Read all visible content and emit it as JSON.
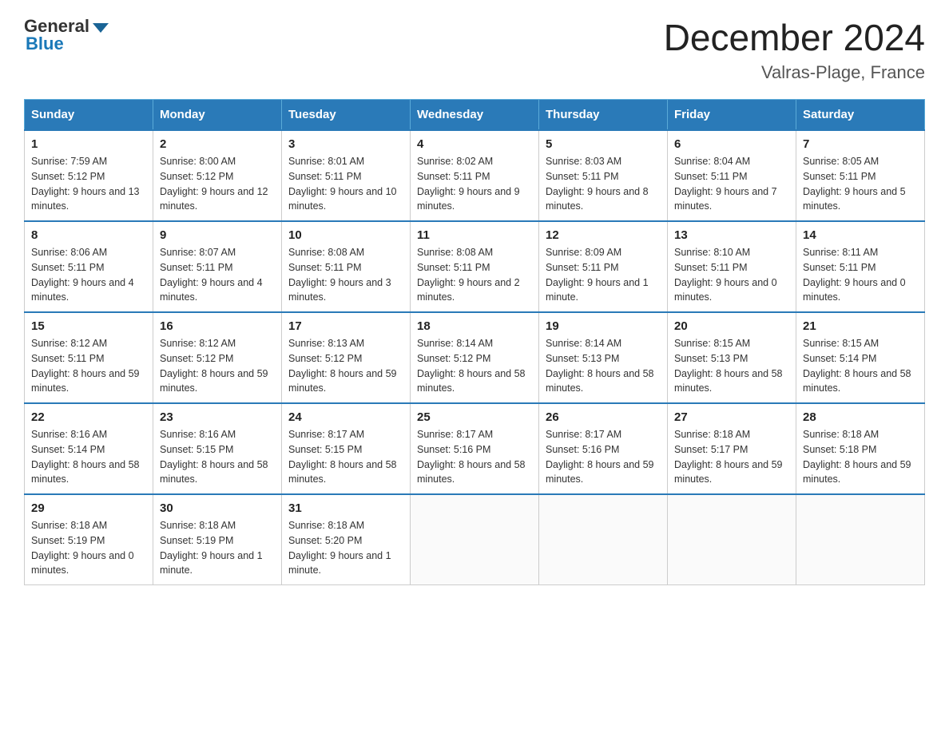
{
  "header": {
    "logo": {
      "general": "General",
      "blue": "Blue"
    },
    "title": "December 2024",
    "location": "Valras-Plage, France"
  },
  "weekdays": [
    "Sunday",
    "Monday",
    "Tuesday",
    "Wednesday",
    "Thursday",
    "Friday",
    "Saturday"
  ],
  "weeks": [
    [
      {
        "day": "1",
        "sunrise": "7:59 AM",
        "sunset": "5:12 PM",
        "daylight": "9 hours and 13 minutes."
      },
      {
        "day": "2",
        "sunrise": "8:00 AM",
        "sunset": "5:12 PM",
        "daylight": "9 hours and 12 minutes."
      },
      {
        "day": "3",
        "sunrise": "8:01 AM",
        "sunset": "5:11 PM",
        "daylight": "9 hours and 10 minutes."
      },
      {
        "day": "4",
        "sunrise": "8:02 AM",
        "sunset": "5:11 PM",
        "daylight": "9 hours and 9 minutes."
      },
      {
        "day": "5",
        "sunrise": "8:03 AM",
        "sunset": "5:11 PM",
        "daylight": "9 hours and 8 minutes."
      },
      {
        "day": "6",
        "sunrise": "8:04 AM",
        "sunset": "5:11 PM",
        "daylight": "9 hours and 7 minutes."
      },
      {
        "day": "7",
        "sunrise": "8:05 AM",
        "sunset": "5:11 PM",
        "daylight": "9 hours and 5 minutes."
      }
    ],
    [
      {
        "day": "8",
        "sunrise": "8:06 AM",
        "sunset": "5:11 PM",
        "daylight": "9 hours and 4 minutes."
      },
      {
        "day": "9",
        "sunrise": "8:07 AM",
        "sunset": "5:11 PM",
        "daylight": "9 hours and 4 minutes."
      },
      {
        "day": "10",
        "sunrise": "8:08 AM",
        "sunset": "5:11 PM",
        "daylight": "9 hours and 3 minutes."
      },
      {
        "day": "11",
        "sunrise": "8:08 AM",
        "sunset": "5:11 PM",
        "daylight": "9 hours and 2 minutes."
      },
      {
        "day": "12",
        "sunrise": "8:09 AM",
        "sunset": "5:11 PM",
        "daylight": "9 hours and 1 minute."
      },
      {
        "day": "13",
        "sunrise": "8:10 AM",
        "sunset": "5:11 PM",
        "daylight": "9 hours and 0 minutes."
      },
      {
        "day": "14",
        "sunrise": "8:11 AM",
        "sunset": "5:11 PM",
        "daylight": "9 hours and 0 minutes."
      }
    ],
    [
      {
        "day": "15",
        "sunrise": "8:12 AM",
        "sunset": "5:11 PM",
        "daylight": "8 hours and 59 minutes."
      },
      {
        "day": "16",
        "sunrise": "8:12 AM",
        "sunset": "5:12 PM",
        "daylight": "8 hours and 59 minutes."
      },
      {
        "day": "17",
        "sunrise": "8:13 AM",
        "sunset": "5:12 PM",
        "daylight": "8 hours and 59 minutes."
      },
      {
        "day": "18",
        "sunrise": "8:14 AM",
        "sunset": "5:12 PM",
        "daylight": "8 hours and 58 minutes."
      },
      {
        "day": "19",
        "sunrise": "8:14 AM",
        "sunset": "5:13 PM",
        "daylight": "8 hours and 58 minutes."
      },
      {
        "day": "20",
        "sunrise": "8:15 AM",
        "sunset": "5:13 PM",
        "daylight": "8 hours and 58 minutes."
      },
      {
        "day": "21",
        "sunrise": "8:15 AM",
        "sunset": "5:14 PM",
        "daylight": "8 hours and 58 minutes."
      }
    ],
    [
      {
        "day": "22",
        "sunrise": "8:16 AM",
        "sunset": "5:14 PM",
        "daylight": "8 hours and 58 minutes."
      },
      {
        "day": "23",
        "sunrise": "8:16 AM",
        "sunset": "5:15 PM",
        "daylight": "8 hours and 58 minutes."
      },
      {
        "day": "24",
        "sunrise": "8:17 AM",
        "sunset": "5:15 PM",
        "daylight": "8 hours and 58 minutes."
      },
      {
        "day": "25",
        "sunrise": "8:17 AM",
        "sunset": "5:16 PM",
        "daylight": "8 hours and 58 minutes."
      },
      {
        "day": "26",
        "sunrise": "8:17 AM",
        "sunset": "5:16 PM",
        "daylight": "8 hours and 59 minutes."
      },
      {
        "day": "27",
        "sunrise": "8:18 AM",
        "sunset": "5:17 PM",
        "daylight": "8 hours and 59 minutes."
      },
      {
        "day": "28",
        "sunrise": "8:18 AM",
        "sunset": "5:18 PM",
        "daylight": "8 hours and 59 minutes."
      }
    ],
    [
      {
        "day": "29",
        "sunrise": "8:18 AM",
        "sunset": "5:19 PM",
        "daylight": "9 hours and 0 minutes."
      },
      {
        "day": "30",
        "sunrise": "8:18 AM",
        "sunset": "5:19 PM",
        "daylight": "9 hours and 1 minute."
      },
      {
        "day": "31",
        "sunrise": "8:18 AM",
        "sunset": "5:20 PM",
        "daylight": "9 hours and 1 minute."
      },
      null,
      null,
      null,
      null
    ]
  ]
}
